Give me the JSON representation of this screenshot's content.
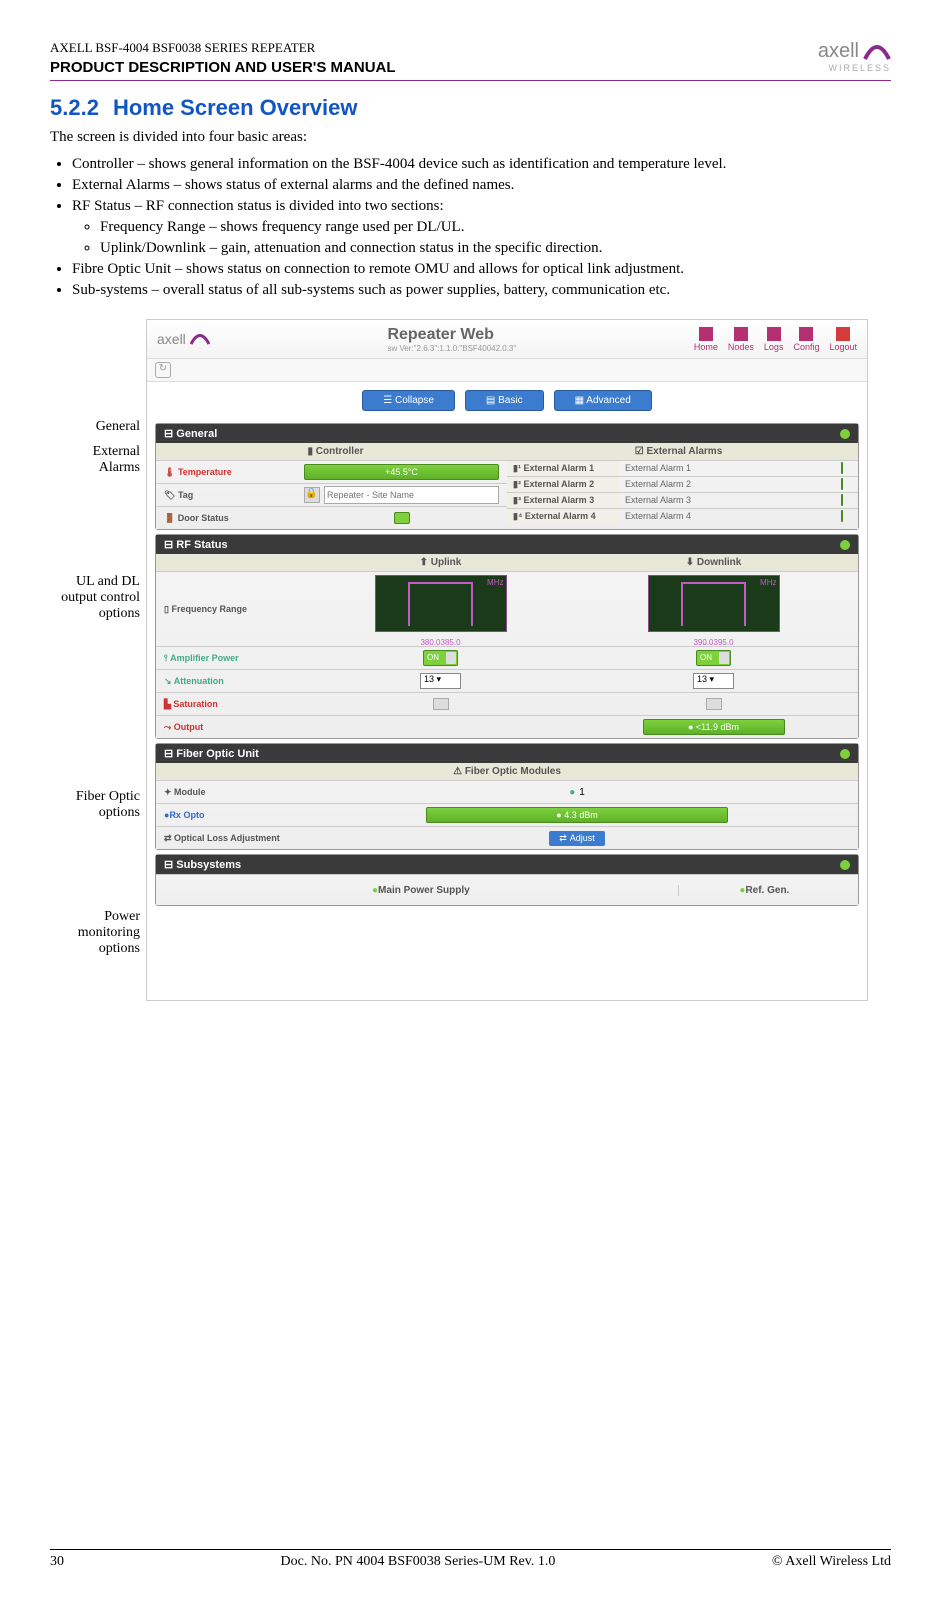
{
  "doc": {
    "header_small": "AXELL BSF-4004 BSF0038 SERIES REPEATER",
    "header_main": "PRODUCT DESCRIPTION AND USER'S MANUAL",
    "logo_text": "axell",
    "logo_sub": "WIRELESS"
  },
  "section": {
    "num": "5.2.2",
    "title": "Home Screen Overview",
    "intro": "The screen is divided into four basic areas:",
    "bullets": [
      "Controller – shows general information on the BSF-4004 device such as identification and temperature level.",
      "External Alarms – shows status of external alarms and the defined names.",
      "RF Status – RF connection status is divided into two sections:",
      "Fibre Optic Unit – shows status on connection to remote OMU and allows for optical link adjustment.",
      "Sub-systems – overall status of all sub-systems such as power supplies, battery, communication etc."
    ],
    "sub_bullets": [
      "Frequency Range – shows frequency range used per DL/UL.",
      "Uplink/Downlink – gain, attenuation and connection status in the specific direction."
    ]
  },
  "callouts": {
    "general": "General",
    "ext": "External Alarms",
    "uldl": "UL and DL output control options",
    "fiber": "Fiber Optic options",
    "power": "Power monitoring options"
  },
  "screenshot": {
    "app_title": "Repeater Web",
    "sw_ver": "sw Ver:\"2.6.3\":1.1.0:\"BSF40042.0.3\"",
    "nav": [
      "Home",
      "Nodes",
      "Logs",
      "Config",
      "Logout"
    ],
    "collapse": "Collapse",
    "basic": "Basic",
    "advanced": "Advanced",
    "general_panel": "General",
    "controller": "Controller",
    "ext_alarms": "External Alarms",
    "temperature": "Temperature",
    "temp_val": "+45.5°C",
    "tag": "Tag",
    "tag_placeholder": "Repeater - Site Name",
    "door": "Door Status",
    "alarms": [
      {
        "name": "External Alarm 1",
        "val": "External Alarm 1"
      },
      {
        "name": "External Alarm 2",
        "val": "External Alarm 2"
      },
      {
        "name": "External Alarm 3",
        "val": "External Alarm 3"
      },
      {
        "name": "External Alarm 4",
        "val": "External Alarm 4"
      }
    ],
    "rf_status": "RF Status",
    "uplink": "Uplink",
    "downlink": "Downlink",
    "freq_range": "Frequency Range",
    "mhz": "MHz",
    "ul_ticks": [
      "380.0",
      "385.0"
    ],
    "dl_ticks": [
      "390.0",
      "395.0"
    ],
    "amp_power": "Amplifier Power",
    "on": "ON",
    "attenuation": "Attenuation",
    "att_val": "13",
    "saturation": "Saturation",
    "output": "Output",
    "output_val": "<11.9 dBm",
    "fiber_panel": "Fiber Optic Unit",
    "fiber_modules": "Fiber Optic Modules",
    "module": "Module",
    "module_num": "1",
    "rx_opto": "Rx Opto",
    "rx_val": "4.3 dBm",
    "opt_loss": "Optical Loss Adjustment",
    "adjust": "Adjust",
    "subsystems": "Subsystems",
    "main_pwr": "Main Power Supply",
    "ref_gen": "Ref. Gen."
  },
  "footer": {
    "page": "30",
    "docno": "Doc. No. PN 4004 BSF0038 Series-UM Rev. 1.0",
    "copyright": "© Axell Wireless Ltd"
  }
}
